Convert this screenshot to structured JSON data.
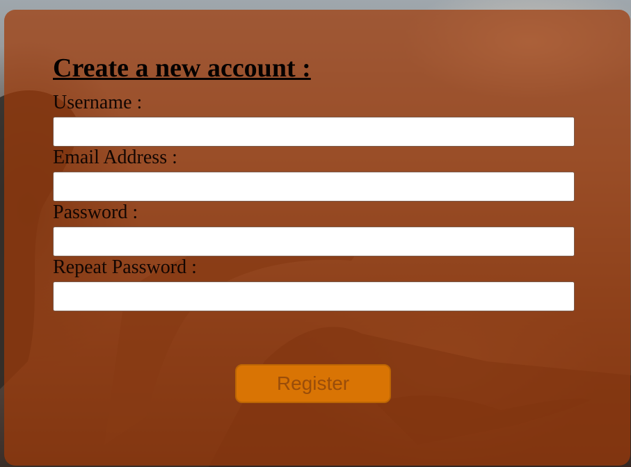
{
  "form": {
    "title": "Create a new account :",
    "fields": [
      {
        "label": "Username :",
        "value": "",
        "placeholder": ""
      },
      {
        "label": "Email Address :",
        "value": "",
        "placeholder": ""
      },
      {
        "label": "Password :",
        "value": "",
        "placeholder": ""
      },
      {
        "label": "Repeat Password :",
        "value": "",
        "placeholder": ""
      }
    ],
    "register_label": "Register"
  },
  "colors": {
    "panel_overlay": "#a03a08",
    "button_fill": "#d97404",
    "button_text": "#9a4d0a",
    "input_fill": "#ffffff"
  },
  "background": {
    "theme": "dinosaur-scene"
  }
}
